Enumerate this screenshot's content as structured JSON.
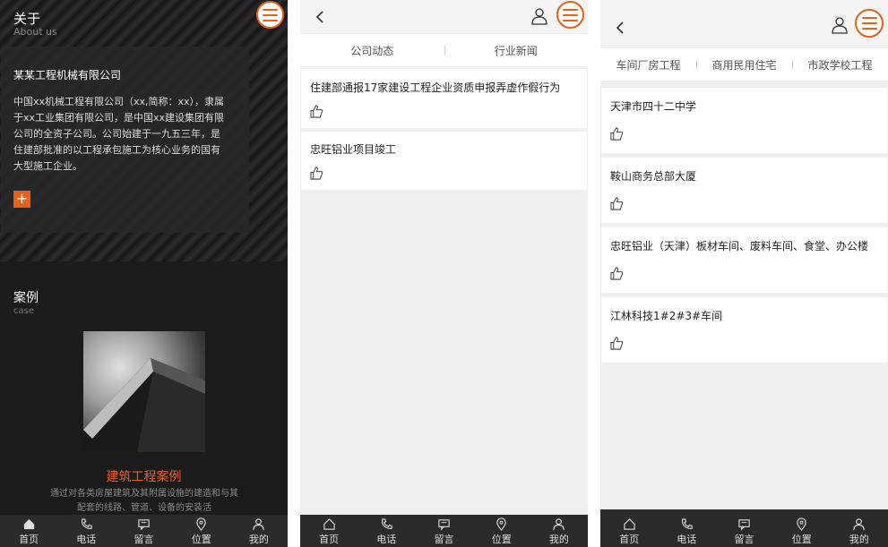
{
  "colors": {
    "accent": "#e8611a",
    "dark_bg": "#1b1b1b",
    "nav_bg": "#2b2b2b"
  },
  "panel1": {
    "about_title": "关于",
    "about_sub": "About us",
    "company_name": "某某工程机械有限公司",
    "company_desc": "中国xx机械工程有限公司（xx,简称：xx），隶属于xx工业集团有限公司，是中国xx建设集团有限公司的全资子公司。公司始建于一九五三年，是住建部批准的以工程承包施工为核心业务的国有大型施工企业。",
    "plus_label": "+",
    "case_title": "案例",
    "case_sub": "case",
    "case_name": "建筑工程案例",
    "case_desc": "通过对各类房屋建筑及其附属设施的建造和与其配套的线路、管道、设备的安装活"
  },
  "panel2": {
    "tabs": [
      "公司动态",
      "行业新闻"
    ],
    "items": [
      {
        "title": "住建部通报17家建设工程企业资质申报弄虚作假行为"
      },
      {
        "title": "忠旺铝业项目竣工"
      }
    ]
  },
  "panel3": {
    "tabs": [
      "车间厂房工程",
      "商用民用住宅",
      "市政学校工程"
    ],
    "items": [
      {
        "title": "天津市四十二中学"
      },
      {
        "title": "鞍山商务总部大厦"
      },
      {
        "title": "忠旺铝业（天津）板材车间、废料车间、食堂、办公楼"
      },
      {
        "title": "江林科技1#2#3#车间"
      }
    ]
  },
  "nav": {
    "items": [
      {
        "label": "首页",
        "icon": "home-icon"
      },
      {
        "label": "电话",
        "icon": "phone-icon"
      },
      {
        "label": "留言",
        "icon": "message-icon"
      },
      {
        "label": "位置",
        "icon": "location-icon"
      },
      {
        "label": "我的",
        "icon": "user-icon"
      }
    ]
  }
}
